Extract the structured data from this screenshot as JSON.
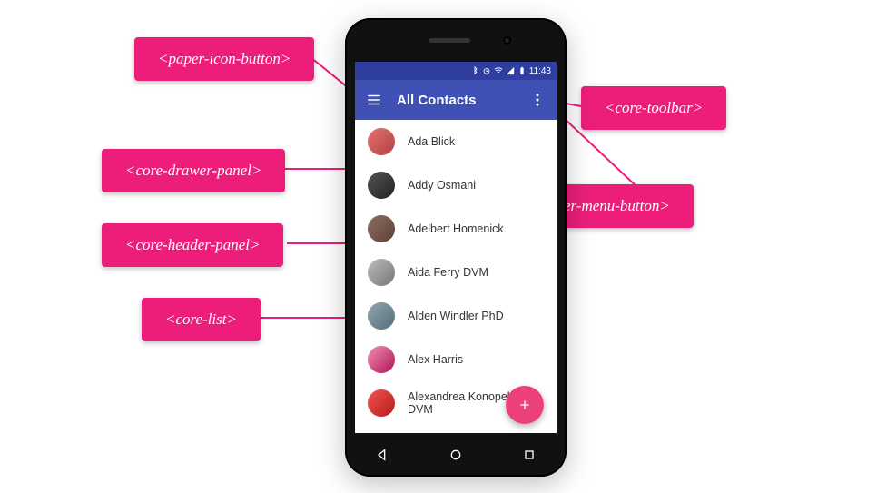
{
  "status": {
    "time": "11:43"
  },
  "toolbar": {
    "title": "All Contacts"
  },
  "contacts": [
    {
      "name": "Ada Blick"
    },
    {
      "name": "Addy Osmani"
    },
    {
      "name": "Adelbert Homenick"
    },
    {
      "name": "Aida Ferry DVM"
    },
    {
      "name": "Alden Windler PhD"
    },
    {
      "name": "Alex Harris"
    },
    {
      "name": "Alexandrea Konopelski DVM"
    }
  ],
  "callouts": {
    "paper_icon_button": "<paper-icon-button>",
    "core_toolbar": "<core-toolbar>",
    "core_drawer_panel": "<core-drawer-panel>",
    "paper_menu_button": "<paper-menu-button>",
    "core_header_panel": "<core-header-panel>",
    "core_list": "<core-list>"
  }
}
